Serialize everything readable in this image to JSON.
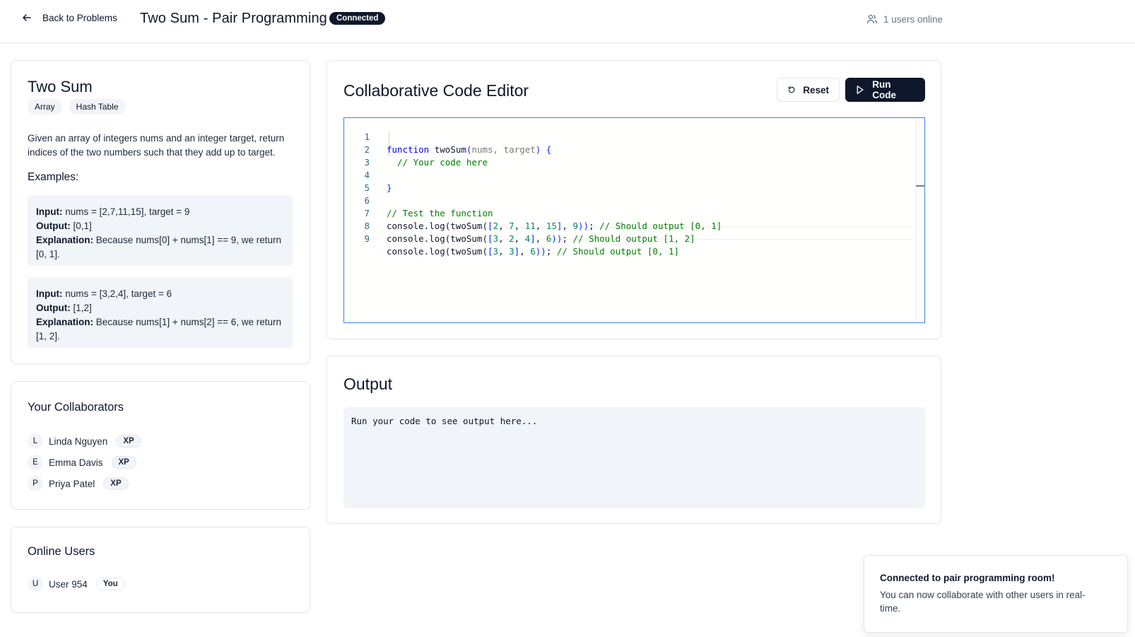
{
  "header": {
    "back_label": "Back to Problems",
    "title": "Two Sum - Pair Programming",
    "status": "Connected",
    "users_online": "1 users online"
  },
  "problem": {
    "title": "Two Sum",
    "tags": [
      "Array",
      "Hash Table"
    ],
    "description": "Given an array of integers nums and an integer target, return indices of the two numbers such that they add up to target.",
    "examples_heading": "Examples:",
    "labels": {
      "input": "Input:",
      "output": "Output:",
      "explanation": "Explanation:"
    },
    "examples": [
      {
        "input": "nums = [2,7,11,15], target = 9",
        "output": "[0,1]",
        "explanation": "Because nums[0] + nums[1] == 9, we return [0, 1]."
      },
      {
        "input": "nums = [3,2,4], target = 6",
        "output": "[1,2]",
        "explanation": "Because nums[1] + nums[2] == 6, we return [1, 2]."
      }
    ]
  },
  "collaborators": {
    "title": "Your Collaborators",
    "people": [
      {
        "initial": "L",
        "name": "Linda Nguyen",
        "badge": "XP"
      },
      {
        "initial": "E",
        "name": "Emma Davis",
        "badge": "XP"
      },
      {
        "initial": "P",
        "name": "Priya Patel",
        "badge": "XP"
      }
    ]
  },
  "online": {
    "title": "Online Users",
    "users": [
      {
        "initial": "U",
        "name": "User 954",
        "badge": "You"
      }
    ]
  },
  "editor": {
    "title": "Collaborative Code Editor",
    "reset_label": "Reset",
    "run_label": "Run Code",
    "line_numbers": [
      "1",
      "2",
      "3",
      "4",
      "5",
      "6",
      "7",
      "8",
      "9"
    ],
    "code": {
      "l1_kw": "function",
      "l1_fn": " twoSum",
      "l1_p1": "(",
      "l1_params": "nums, target",
      "l1_p2": ") {",
      "l2": "  // Your code here",
      "l4": "}",
      "l6": "// Test the function",
      "l7_a": "console.log(twoSum(",
      "l7_b": "[",
      "l7_n1": "2",
      "l7_n2": "7",
      "l7_n3": "11",
      "l7_n4": "15",
      "l7_n5": "9",
      "l7_c": "// Should output [0, 1]",
      "l8_n1": "3",
      "l8_n2": "2",
      "l8_n3": "4",
      "l8_n4": "6",
      "l8_c": "// Should output [1, 2]",
      "l9_n1": "3",
      "l9_n2": "3",
      "l9_n3": "6",
      "l9_c": "// Should output [0, 1]"
    }
  },
  "output": {
    "title": "Output",
    "placeholder": "Run your code to see output here..."
  },
  "toast": {
    "title": "Connected to pair programming room!",
    "description": "You can now collaborate with other users in real-time."
  }
}
